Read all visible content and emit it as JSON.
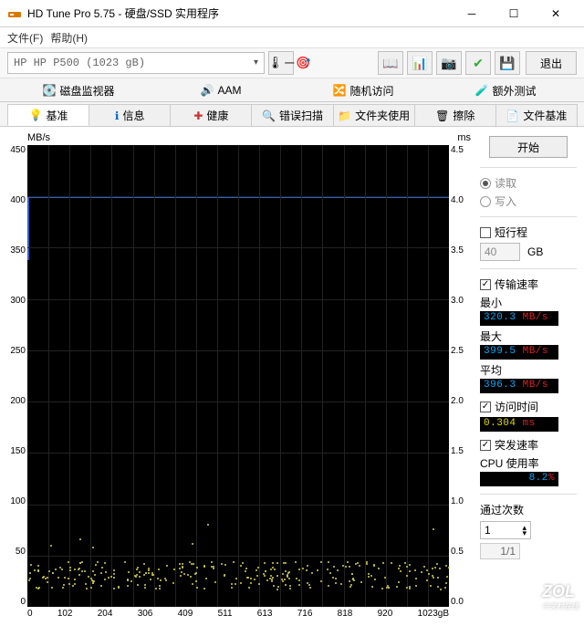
{
  "window": {
    "title": "HD Tune Pro 5.75 - 硬盘/SSD 实用程序"
  },
  "menu": {
    "file": "文件(F)",
    "help": "帮助(H)"
  },
  "toolbar": {
    "drive": "HP    HP P500 (1023 gB)",
    "exit": "退出"
  },
  "primary_tabs": {
    "disk_monitor": "磁盘监视器",
    "aam": "AAM",
    "random_access": "随机访问",
    "extra_tests": "额外测试"
  },
  "secondary_tabs": {
    "benchmark": "基准",
    "info": "信息",
    "health": "健康",
    "error_scan": "错误扫描",
    "folder_usage": "文件夹使用",
    "erase": "擦除",
    "file_benchmark": "文件基准"
  },
  "chart_labels": {
    "left_unit": "MB/s",
    "right_unit": "ms"
  },
  "chart_data": {
    "type": "line+scatter",
    "xlabel": "gB",
    "x_ticks": [
      "0",
      "102",
      "204",
      "306",
      "409",
      "511",
      "613",
      "716",
      "818",
      "920",
      "1023gB"
    ],
    "y_left_label": "MB/s",
    "y_left_range": [
      0,
      450
    ],
    "y_left_ticks": [
      450,
      400,
      350,
      300,
      250,
      200,
      150,
      100,
      50,
      0
    ],
    "y_right_label": "ms",
    "y_right_range": [
      0,
      4.5
    ],
    "y_right_ticks": [
      "4.5",
      "4.0",
      "3.5",
      "3.0",
      "2.5",
      "2.0",
      "1.5",
      "1.0",
      "0.5",
      "0.0"
    ],
    "series": [
      {
        "name": "transfer_rate",
        "axis": "left",
        "type": "line",
        "color": "#2b5fc7",
        "approx_value": 398,
        "note": "nearly flat line around 396-400 MB/s across full range, initial dip near 320 at x~0"
      },
      {
        "name": "access_time",
        "axis": "right",
        "type": "scatter",
        "color": "#d6d24a",
        "approx_center": 0.3,
        "approx_spread": [
          0.15,
          0.5
        ],
        "note": "scattered points around 0.3 ms across full range"
      }
    ]
  },
  "side": {
    "start": "开始",
    "read": "读取",
    "write": "写入",
    "short_stroke": "短行程",
    "short_stroke_value": "40",
    "short_stroke_unit": "GB",
    "transfer_rate": "传输速率",
    "min_label": "最小",
    "min_value": "320.3 ",
    "min_unit": "MB/s",
    "max_label": "最大",
    "max_value": "399.5 ",
    "max_unit": "MB/s",
    "avg_label": "平均",
    "avg_value": "396.3 ",
    "avg_unit": "MB/s",
    "access_time": "访问时间",
    "access_value": "0.304 ",
    "access_unit": "ms",
    "burst_rate": "突发速率",
    "cpu_usage": "CPU 使用率",
    "cpu_value": "8.2",
    "cpu_unit": "%",
    "passes": "通过次数",
    "pass_count": "1",
    "pass_progress": "1/1"
  },
  "watermark": {
    "main": "ZOL",
    "sub": "中关村在线"
  }
}
